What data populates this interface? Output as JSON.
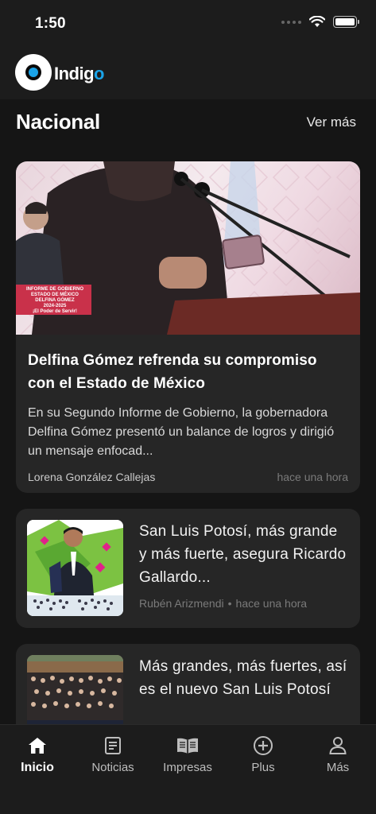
{
  "status_bar": {
    "time": "1:50"
  },
  "header": {
    "logo_text": "Indig",
    "logo_text_end": "o",
    "accent_color": "#1aa3e8"
  },
  "section": {
    "title": "Nacional",
    "see_more": "Ver más"
  },
  "featured": {
    "title": "Delfina Gómez refrenda su compromiso con el Estado de México",
    "summary": "En su Segundo Informe de Gobierno, la gobernadora Delfina Gómez presentó un balance de logros y dirigió un mensaje enfocad...",
    "author": "Lorena González Callejas",
    "time": "hace una hora",
    "image_banner": {
      "line1": "INFORME DE GOBIERNO",
      "line2": "ESTADO DE MÉXICO",
      "line3": "DELFINA GÓMEZ",
      "line4": "2024-2025",
      "line5": "¡El Poder de Servir!"
    }
  },
  "articles": [
    {
      "title": "San Luis Potosí, más grande y más fuerte, asegura Ricardo Gallardo...",
      "author": "Rubén Arizmendi",
      "separator": "•",
      "time": "hace una hora"
    },
    {
      "title": "Más grandes, más fuertes, así es el nuevo San Luis Potosí",
      "author": "",
      "separator": "",
      "time": ""
    }
  ],
  "tabs": [
    {
      "label": "Inicio",
      "icon": "home-icon",
      "active": true
    },
    {
      "label": "Noticias",
      "icon": "news-icon",
      "active": false
    },
    {
      "label": "Impresas",
      "icon": "book-icon",
      "active": false
    },
    {
      "label": "Plus",
      "icon": "plus-circle-icon",
      "active": false
    },
    {
      "label": "Más",
      "icon": "person-icon",
      "active": false
    }
  ]
}
